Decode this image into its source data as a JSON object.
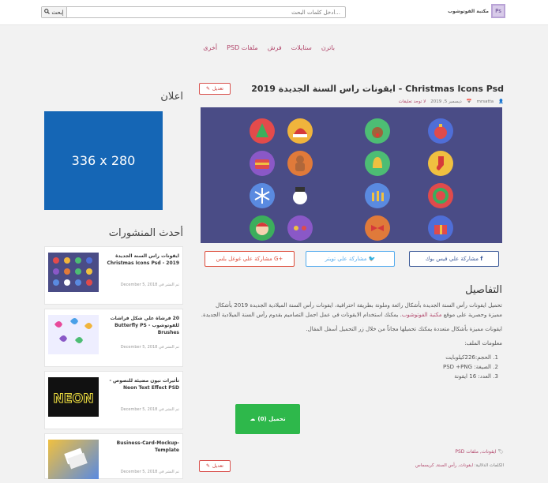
{
  "header": {
    "search_button": "إبحث",
    "search_placeholder": "أدخل كلمات البحث...",
    "logo_text": "مكتبة الفوتوشوب"
  },
  "nav": {
    "items": [
      "باترن",
      "ستايلات",
      "فرش",
      "ملفات PSD",
      "أخرى"
    ]
  },
  "post": {
    "edit_label": "تعديل",
    "title": "ايقونات راس السنة الجديدة 2019 - Christmas Icons Psd",
    "author": "mrsatta",
    "date": "ديسمبر 5, 2019",
    "comments": "لا توجد تعليقات",
    "share": {
      "facebook": "مشاركة علي فيس بوك",
      "twitter": "مشاركة علي تويتر",
      "google": "مشاركة علي غوغل بلس"
    },
    "details_title": "التفاصيل",
    "p1_start": "تحميل ايقونات رأس السنة الجديدة بأشكال رائعة وملونة بطريقة احترافية، ايقونات رأس السنة الميلادية الجديدة 2019 بأشكال مميزة وحصرية على موقع",
    "p1_link": "مكتبة الفوتوشوب",
    "p1_end": ". يمكنك استخدام الايقونات في عمل اجمل التصاميم بقدوم رأس السنة الميلادية الجديدة.",
    "p2": "ايقونات مميزة بأشكال متعددة يمكنك تحميلها مجاناً من خلال زر التحميل أسفل المقال.",
    "info_label": "معلومات الملف:",
    "info": [
      "الحجم:226كيلوبايت",
      "الصيغة: PSD +PNG",
      "العدد: 16 ايقونة"
    ],
    "download": "تحميل (0)",
    "tags_line": "ايقونات, ملفات PSD",
    "keywords_label": "الكلمات الدلالية:",
    "keywords": "ايقونات, رأس السنة, كريسماس"
  },
  "sidebar": {
    "ad_title": "اعلان",
    "ad_label": "336 x 280",
    "recent_title": "أحدث المنشورات",
    "posts": [
      {
        "title": "ايقونات راس السنة الجديدة 2019 - Christmas Icons Psd",
        "date": "تم النشر في December 5, 2018"
      },
      {
        "title": "20 فرشاة علي شكل فراشات للفوتوشوب - Butterfly PS Brushes",
        "date": "تم النشر في December 5, 2018"
      },
      {
        "title": "تأثيرات نيون مضيئة للنصوص - Neon Text Effect PSD",
        "date": "تم النشر في December 5, 2018"
      },
      {
        "title": "Business-Card-Mockup-Template",
        "date": "تم النشر في December 5, 2018"
      }
    ]
  },
  "icons": {
    "search": "search-icon",
    "user": "user-icon",
    "calendar": "calendar-icon",
    "comment": "comment-icon",
    "download": "cloud-download-icon",
    "tag": "tag-icon",
    "edit": "pencil-icon"
  },
  "colors": {
    "accent": "#b1456a",
    "download": "#2eb84b",
    "hero_bg": "#4a4c86",
    "ad_bg": "#1566b5"
  }
}
